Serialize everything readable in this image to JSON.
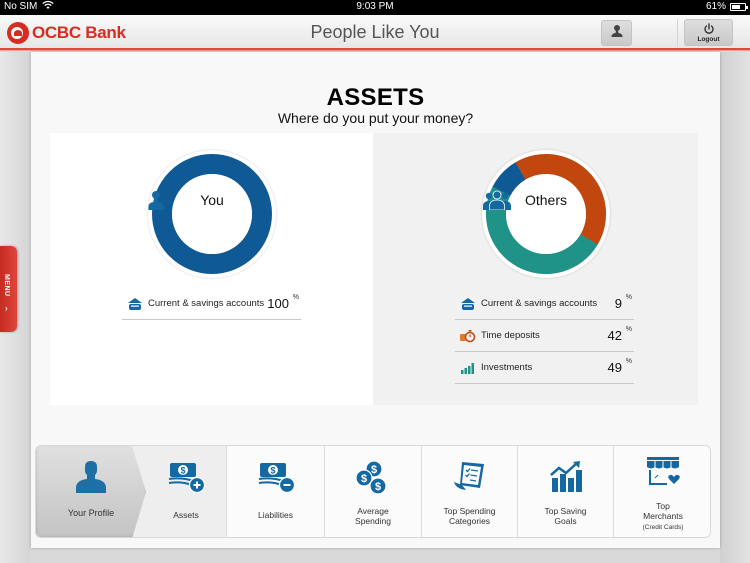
{
  "status_bar": {
    "carrier": "No SIM",
    "wifi_icon": "wifi-icon",
    "time": "9:03 PM",
    "battery": "61%",
    "battery_icon": "battery-icon"
  },
  "nav": {
    "brand": "OCBC Bank",
    "title": "People Like You",
    "profile_icon": "person-icon",
    "logout_label": "Logout",
    "logout_icon": "power-icon"
  },
  "side_menu": {
    "label": "MENU",
    "chevron": "›"
  },
  "page": {
    "heading": "ASSETS",
    "subheading": "Where do you put your money?"
  },
  "you_panel": {
    "label": "You",
    "icon": "person-icon",
    "legend": [
      {
        "icon": "piggy-bank-icon",
        "label": "Current & savings accounts",
        "value": "100",
        "unit": "%"
      }
    ]
  },
  "others_panel": {
    "label": "Others",
    "icon": "group-icon",
    "legend": [
      {
        "icon": "piggy-bank-icon",
        "label": "Current & savings accounts",
        "value": "9",
        "unit": "%"
      },
      {
        "icon": "stopwatch-coins-icon",
        "label": "Time deposits",
        "value": "42",
        "unit": "%"
      },
      {
        "icon": "bar-chart-icon",
        "label": "Investments",
        "value": "49",
        "unit": "%"
      }
    ]
  },
  "colors": {
    "brand_red": "#d82c20",
    "savings_blue": "#0f5a94",
    "time_deposit_orange": "#c2470e",
    "investment_teal": "#1f9388",
    "icon_blue": "#1469a3"
  },
  "chart_data": [
    {
      "type": "pie",
      "title": "You",
      "categories": [
        "Current & savings accounts"
      ],
      "values": [
        100
      ],
      "colors": [
        "#0f5a94"
      ]
    },
    {
      "type": "pie",
      "title": "Others",
      "categories": [
        "Current & savings accounts",
        "Time deposits",
        "Investments"
      ],
      "values": [
        9,
        42,
        49
      ],
      "colors": [
        "#0f5a94",
        "#c2470e",
        "#1f9388"
      ]
    }
  ],
  "tabs": [
    {
      "id": "profile",
      "label": "Your Profile",
      "icon": "person-icon",
      "state": "back"
    },
    {
      "id": "assets",
      "label": "Assets",
      "icon": "money-plus-icon",
      "state": "active"
    },
    {
      "id": "liabilities",
      "label": "Liabilities",
      "icon": "money-minus-icon"
    },
    {
      "id": "average-spending",
      "label_line1": "Average",
      "label_line2": "Spending",
      "icon": "coins-icon"
    },
    {
      "id": "top-spending",
      "label_line1": "Top Spending",
      "label_line2": "Categories",
      "icon": "receipt-icon"
    },
    {
      "id": "top-saving",
      "label_line1": "Top Saving",
      "label_line2": "Goals",
      "icon": "growth-chart-icon"
    },
    {
      "id": "top-merchants",
      "label_line1": "Top",
      "label_line2": "Merchants",
      "label_note": "(Credit Cards)",
      "icon": "storefront-icon"
    }
  ]
}
